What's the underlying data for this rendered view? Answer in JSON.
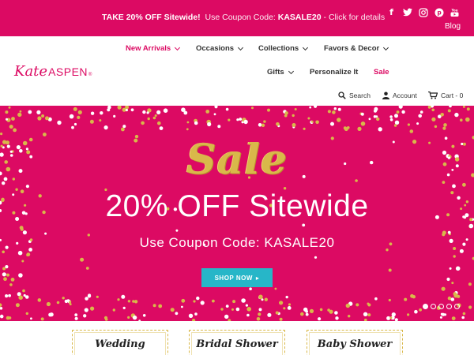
{
  "promo": {
    "bold_text": "TAKE 20% OFF Sitewide!",
    "coupon_text": "Use Coupon Code:",
    "coupon_code": "KASALE20",
    "cta_text": "- Click for details"
  },
  "social": {
    "icons": [
      "facebook-icon",
      "twitter-icon",
      "instagram-icon",
      "pinterest-icon",
      "youtube-icon"
    ],
    "glyphs": [
      "f",
      "t",
      "◎",
      "p",
      "▶"
    ],
    "blog_label": "Blog"
  },
  "logo": {
    "kate": "Kate",
    "aspen": "ASPEN",
    "mark": "®"
  },
  "nav": {
    "new_arrivals": "New Arrivals",
    "occasions": "Occasions",
    "collections": "Collections",
    "favors_decor": "Favors & Decor",
    "gifts": "Gifts",
    "personalize": "Personalize It",
    "sale": "Sale"
  },
  "utility": {
    "search": "Search",
    "account": "Account",
    "cart": "Cart - 0"
  },
  "hero": {
    "sale_word": "Sale",
    "headline": "20% OFF Sitewide",
    "subline": "Use Coupon Code: KASALE20",
    "button": "SHOP NOW",
    "button_arrow": "▸",
    "slide_count": 5,
    "active_slide": 1
  },
  "categories": [
    "Wedding",
    "Bridal Shower",
    "Baby Shower"
  ],
  "colors": {
    "brand_pink": "#dc0a63",
    "gold": "#d9b84a",
    "teal_button": "#27b6c8"
  }
}
